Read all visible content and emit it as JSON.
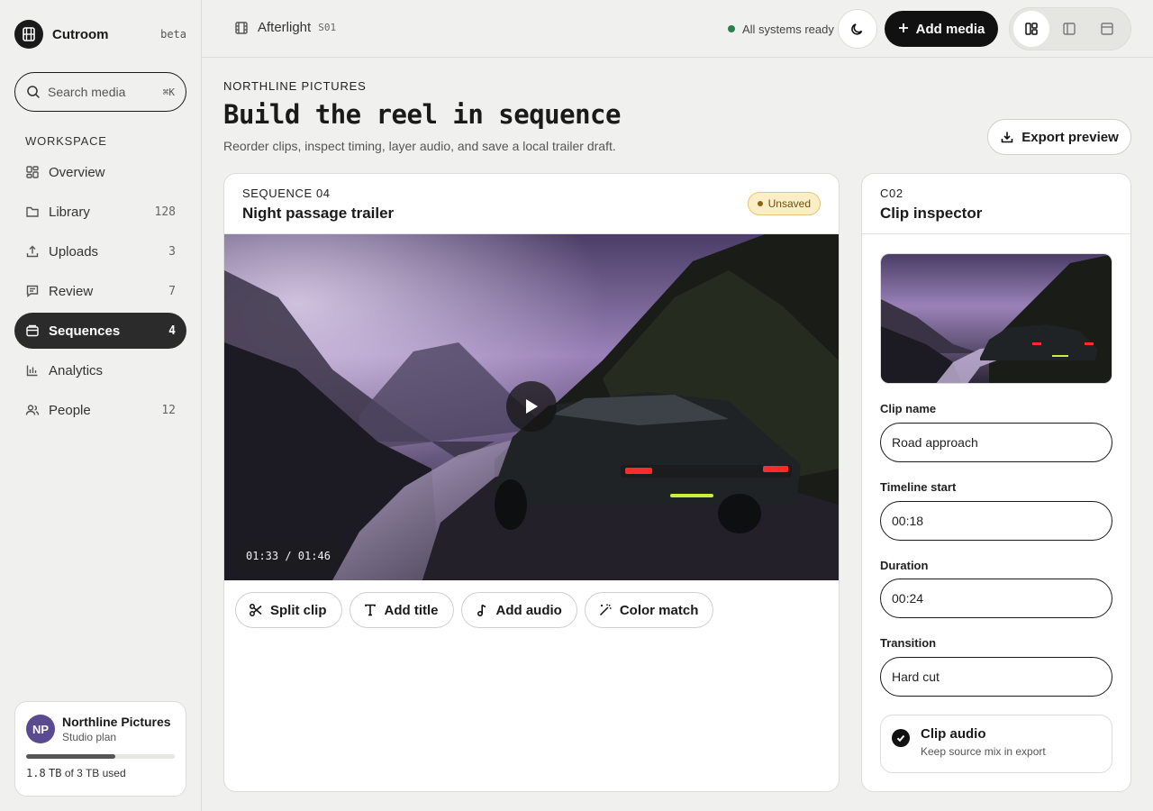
{
  "brand": {
    "name": "Cutroom",
    "tag": "beta"
  },
  "search": {
    "placeholder": "Search media",
    "shortcut": "⌘K"
  },
  "workspace_label": "WORKSPACE",
  "nav": [
    {
      "label": "Overview",
      "count": "",
      "icon": "grid-icon",
      "active": false
    },
    {
      "label": "Library",
      "count": "128",
      "icon": "folder-icon",
      "active": false
    },
    {
      "label": "Uploads",
      "count": "3",
      "icon": "upload-icon",
      "active": false
    },
    {
      "label": "Review",
      "count": "7",
      "icon": "message-icon",
      "active": false
    },
    {
      "label": "Sequences",
      "count": "4",
      "icon": "film-stack-icon",
      "active": true
    },
    {
      "label": "Analytics",
      "count": "",
      "icon": "bar-chart-icon",
      "active": false
    },
    {
      "label": "People",
      "count": "12",
      "icon": "people-icon",
      "active": false
    }
  ],
  "org": {
    "initials": "NP",
    "name": "Northline Pictures",
    "plan": "Studio plan",
    "used": "1.8",
    "used_unit": "TB",
    "used_suffix": "of 3 TB used",
    "usage_fraction": 0.6
  },
  "topbar": {
    "project": "Afterlight",
    "project_code": "S01",
    "status": "All systems ready",
    "add_media_label": "Add media"
  },
  "page": {
    "eyebrow": "NORTHLINE PICTURES",
    "title": "Build the reel in sequence",
    "subtitle": "Reorder clips, inspect timing, layer audio, and save a local trailer draft.",
    "export_label": "Export preview"
  },
  "sequence": {
    "kicker": "SEQUENCE 04",
    "title": "Night passage trailer",
    "badge": "Unsaved",
    "timecode": "01:33 / 01:46",
    "tools": [
      "Split clip",
      "Add title",
      "Add audio",
      "Color match"
    ]
  },
  "inspector": {
    "kicker": "C02",
    "title": "Clip inspector",
    "fields": {
      "clip_name_label": "Clip name",
      "clip_name_value": "Road approach",
      "start_label": "Timeline start",
      "start_value": "00:18",
      "duration_label": "Duration",
      "duration_value": "00:24",
      "transition_label": "Transition",
      "transition_value": "Hard cut"
    },
    "audio_title": "Clip audio",
    "audio_sub": "Keep source mix in export"
  },
  "colors": {
    "accent": "#111111",
    "status_ok": "#2e7d4f",
    "badge_bg": "#fbeec7",
    "avatar": "#5a4a8f"
  }
}
